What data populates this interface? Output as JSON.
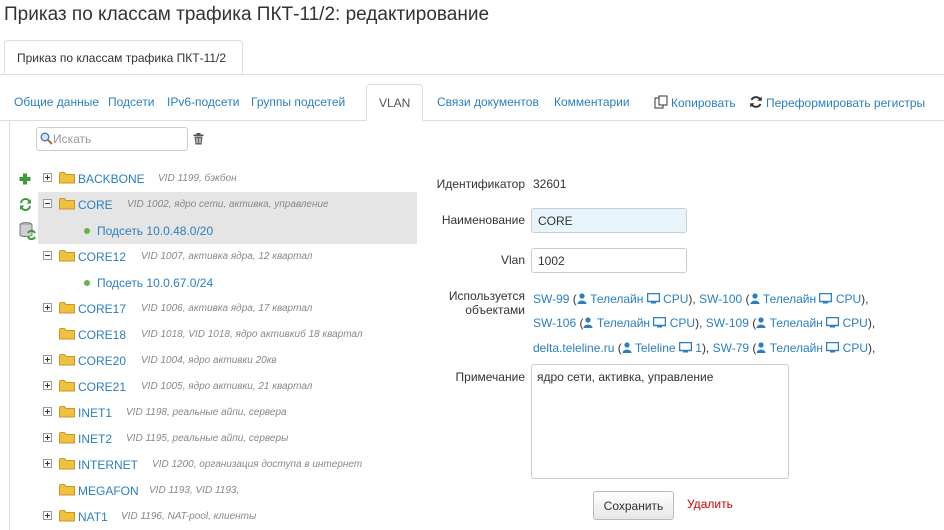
{
  "page": {
    "title": "Приказ по классам трафика ПКТ-11/2: редактирование"
  },
  "outer_tab": {
    "label": "Приказ по классам трафика ПКТ-11/2"
  },
  "tabs": [
    {
      "label": "Общие данные"
    },
    {
      "label": "Подсети"
    },
    {
      "label": "IPv6-подсети"
    },
    {
      "label": "Группы подсетей"
    },
    {
      "label": "VLAN",
      "active": true
    },
    {
      "label": "Связи документов"
    },
    {
      "label": "Комментарии"
    }
  ],
  "actions": {
    "copy": "Копировать",
    "reform": "Переформировать регистры"
  },
  "search": {
    "placeholder": "Искать",
    "value": ""
  },
  "tree": [
    {
      "name": "BACKBONE",
      "desc": "VID 1199, бэкбон",
      "expander": "plus"
    },
    {
      "name": "CORE",
      "desc": "VID 1002, ядро сети, активка, управление",
      "expander": "minus",
      "selected": true,
      "children": [
        {
          "name": "Подсеть 10.0.48.0/20"
        }
      ]
    },
    {
      "name": "CORE12",
      "desc": "VID 1007, активка ядра, 12 квартал",
      "expander": "minus",
      "children": [
        {
          "name": "Подсеть 10.0.67.0/24"
        }
      ]
    },
    {
      "name": "CORE17",
      "desc": "VID 1006, активка ядра, 17 квартал",
      "expander": "plus"
    },
    {
      "name": "CORE18",
      "desc": "VID 1018, VID 1018, ядро активкиб 18 квартал",
      "expander": "none"
    },
    {
      "name": "CORE20",
      "desc": "VID 1004, ядро активки 20кв",
      "expander": "plus"
    },
    {
      "name": "CORE21",
      "desc": "VID 1005, ядро активки, 21 квартал",
      "expander": "plus"
    },
    {
      "name": "INET1",
      "desc": "VID 1198, реальные айпи, сервера",
      "expander": "plus"
    },
    {
      "name": "INET2",
      "desc": "VID 1195, реальные айпи, серверы",
      "expander": "plus"
    },
    {
      "name": "INTERNET",
      "desc": "VID 1200, организация доступа в интернет",
      "expander": "plus"
    },
    {
      "name": "MEGAFON",
      "desc": "VID 1193, VID 1193,",
      "expander": "none"
    },
    {
      "name": "NAT1",
      "desc": "VID 1196, NAT-pool, клиенты",
      "expander": "plus"
    }
  ],
  "form": {
    "id_label": "Идентификатор",
    "id_value": "32601",
    "name_label": "Наименование",
    "name_value": "CORE",
    "vlan_label": "Vlan",
    "vlan_value": "1002",
    "used_label_1": "Используется",
    "used_label_2": "объектами",
    "used_by": [
      {
        "device": "SW-99",
        "owner": "Телелайн",
        "port": "CPU"
      },
      {
        "device": "SW-100",
        "owner": "Телелайн",
        "port": "CPU"
      },
      {
        "device": "SW-106",
        "owner": "Телелайн",
        "port": "CPU"
      },
      {
        "device": "SW-109",
        "owner": "Телелайн",
        "port": "CPU"
      },
      {
        "device": "delta.teleline.ru",
        "owner": "Teleline",
        "port": "1"
      },
      {
        "device": "SW-79",
        "owner": "Телелайн",
        "port": "CPU"
      }
    ],
    "note_label": "Примечание",
    "note_value": "ядро сети, активка, управление",
    "save_label": "Сохранить",
    "delete_label": "Удалить"
  },
  "colors": {
    "link": "#2a7fc1",
    "delete": "#cc0000",
    "selected_row": "#e5e5e5",
    "folder": "#f0c040",
    "dot": "#6ab04c"
  }
}
